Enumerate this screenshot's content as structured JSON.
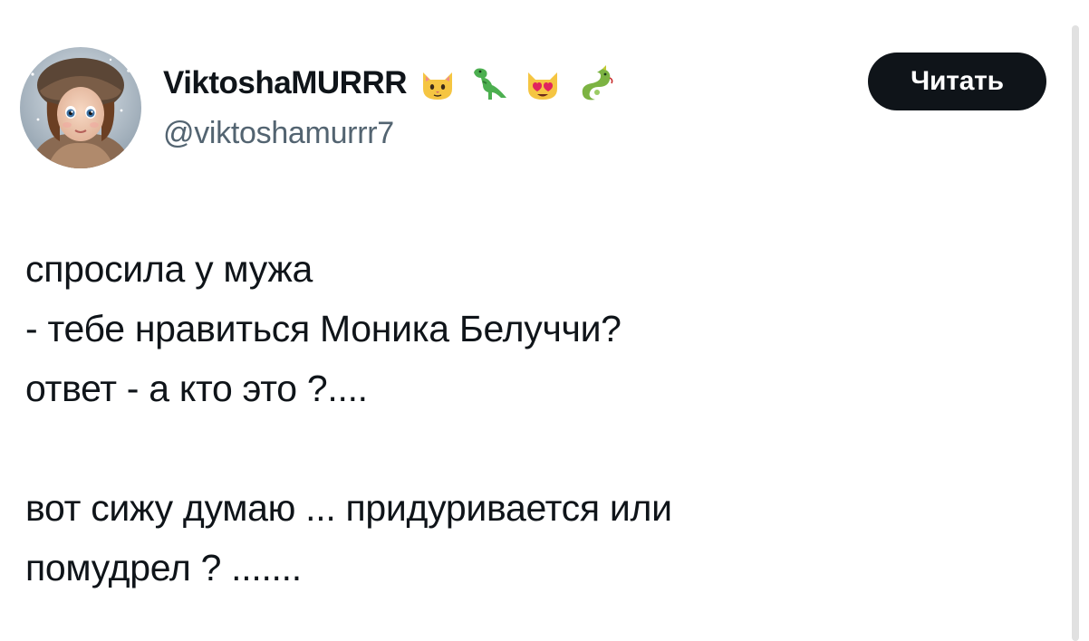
{
  "author": {
    "display_name": "ViktoshaMURRR",
    "handle": "@viktoshamurrr7",
    "name_emojis": [
      "cat-face-icon",
      "t-rex-icon",
      "heart-eyes-cat-icon",
      "dragon-icon"
    ]
  },
  "follow_button": {
    "label": "Читать"
  },
  "tweet": {
    "lines": [
      "спросила у мужа",
      "- тебе нравиться Моника Белуччи?",
      "ответ - а кто это ?....",
      "",
      "вот сижу думаю ... придуривается или",
      "помудрел ? ......."
    ]
  },
  "colors": {
    "text": "#0f1419",
    "secondary_text": "#536471",
    "button_bg": "#0f1419",
    "button_text": "#ffffff",
    "background": "#ffffff"
  }
}
